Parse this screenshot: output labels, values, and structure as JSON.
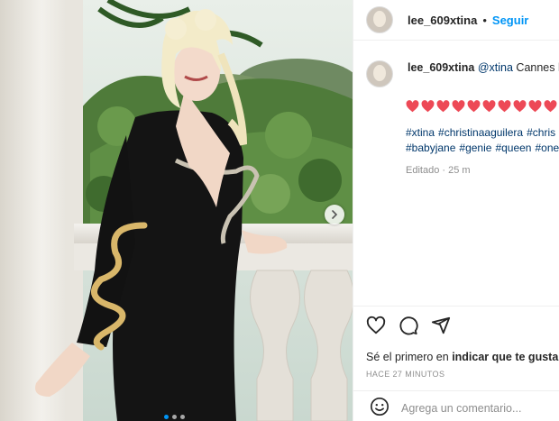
{
  "post": {
    "username": "lee_609xtina",
    "separator": "•",
    "follow_label": "Seguir"
  },
  "caption": {
    "username": "lee_609xtina",
    "mention": "@xtina",
    "text": " Cannes ha",
    "heart_count": 10,
    "heart_color": "#ed4956",
    "hashtags_line1": [
      "#xtina",
      "#christinaaguilera",
      "#chris"
    ],
    "hashtags_line2": [
      "#babyjane",
      "#genie",
      "#queen",
      "#one"
    ],
    "edited": "Editado · 25 m"
  },
  "engagement": {
    "likes_prefix": "Sé el primero en ",
    "likes_bold": "indicar que te gusta e",
    "timestamp": "HACE 27 MINUTOS"
  },
  "comment": {
    "placeholder": "Agrega un comentario..."
  },
  "carousel": {
    "dots": 3,
    "active_index": 0
  },
  "icons": [
    "heart-icon",
    "comment-icon",
    "share-icon",
    "emoji-icon",
    "chevron-right-icon"
  ]
}
